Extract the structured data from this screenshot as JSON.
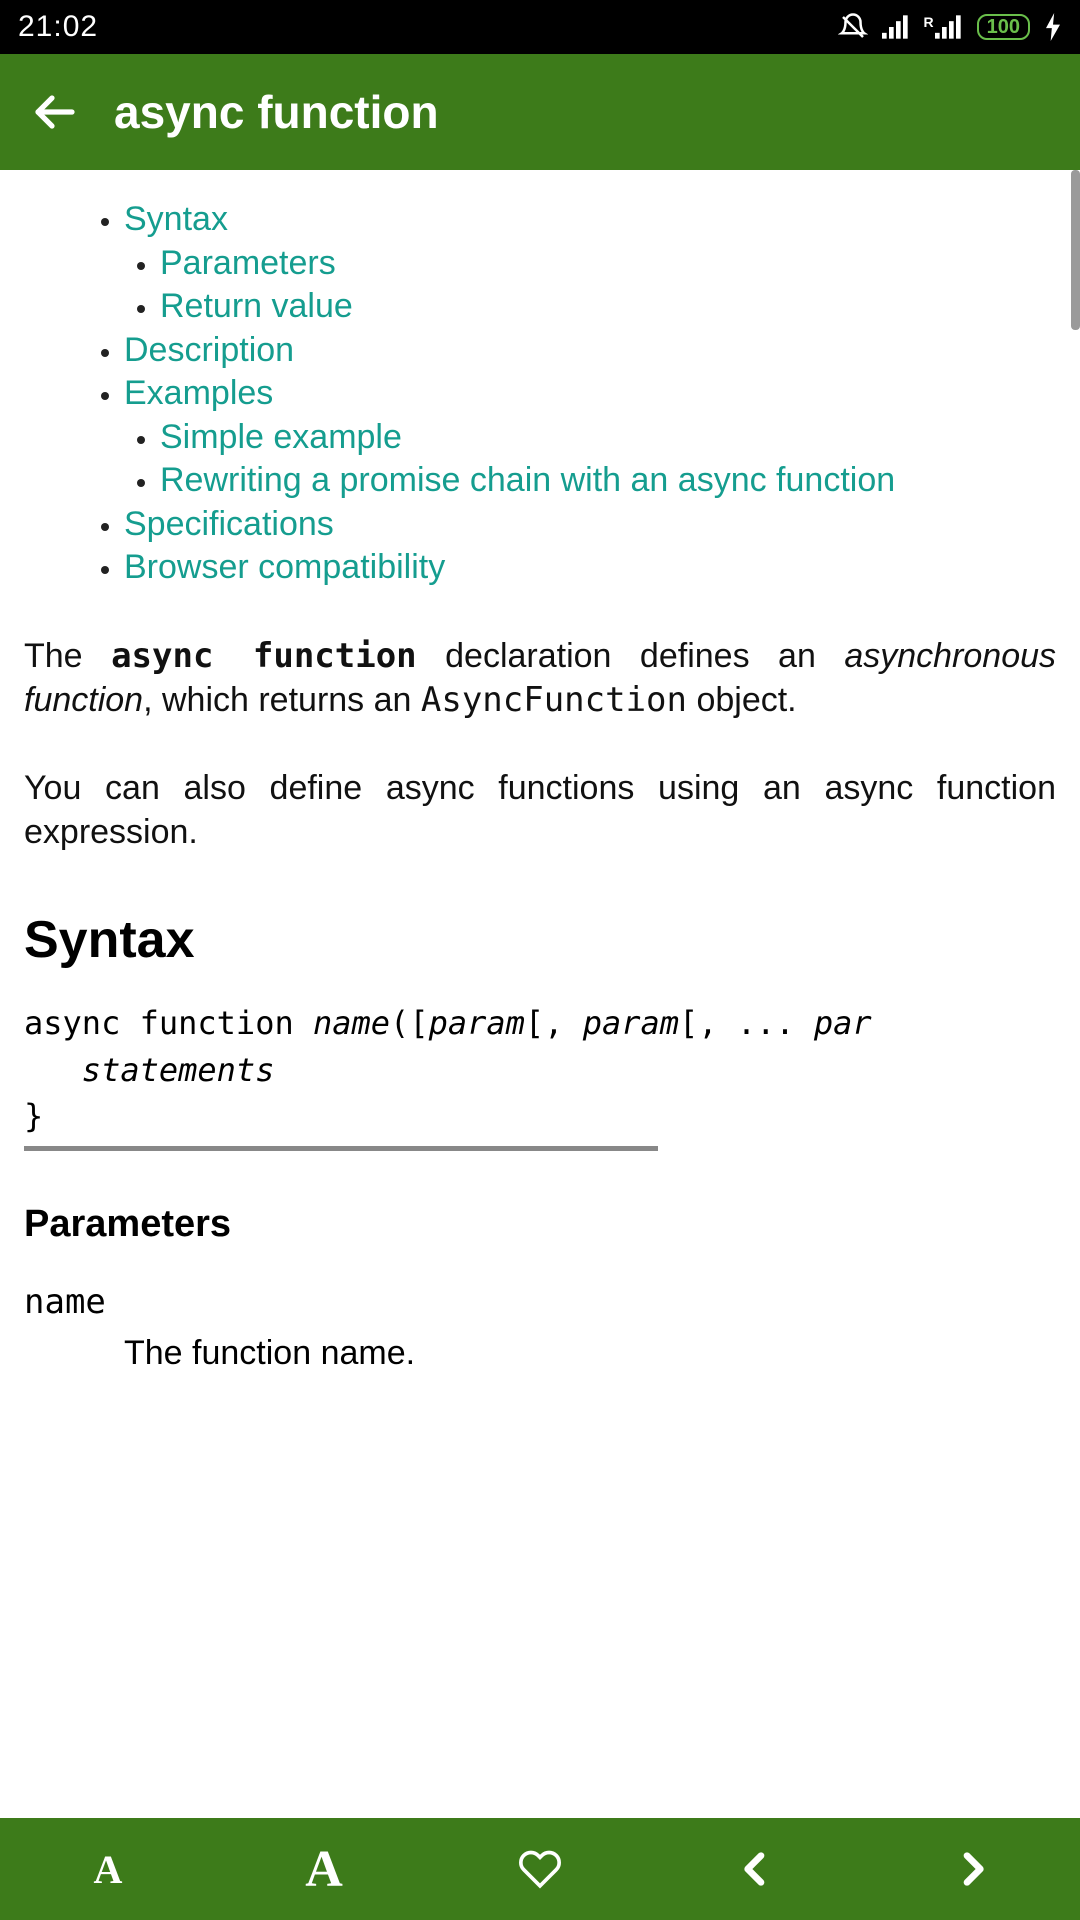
{
  "status": {
    "time": "21:02",
    "battery": "100"
  },
  "header": {
    "title": "async function"
  },
  "toc": {
    "items": [
      {
        "label": "Syntax",
        "children": [
          {
            "label": "Parameters"
          },
          {
            "label": "Return value"
          }
        ]
      },
      {
        "label": "Description"
      },
      {
        "label": "Examples",
        "children": [
          {
            "label": "Simple example"
          },
          {
            "label": "Rewriting a promise chain with an async function"
          }
        ]
      },
      {
        "label": "Specifications"
      },
      {
        "label": "Browser compatibility"
      }
    ]
  },
  "intro": {
    "p1_pre": "The ",
    "p1_code": "async function",
    "p1_mid": " declaration defines an ",
    "p1_ital": "asynchronous function",
    "p1_mid2": ", which returns an ",
    "p1_obj": "AsyncFunction",
    "p1_post": " object.",
    "p2": "You can also define async functions using an async function expression."
  },
  "syntax": {
    "heading": "Syntax",
    "code_l1_a": "async function ",
    "code_l1_b": "name",
    "code_l1_c": "([",
    "code_l1_d": "param",
    "code_l1_e": "[, ",
    "code_l1_f": "param",
    "code_l1_g": "[, ... ",
    "code_l1_h": "par",
    "code_l2_indent": "   ",
    "code_l2": "statements",
    "code_l3": "}"
  },
  "params": {
    "heading": "Parameters",
    "name_term": "name",
    "name_desc": "The function name."
  }
}
